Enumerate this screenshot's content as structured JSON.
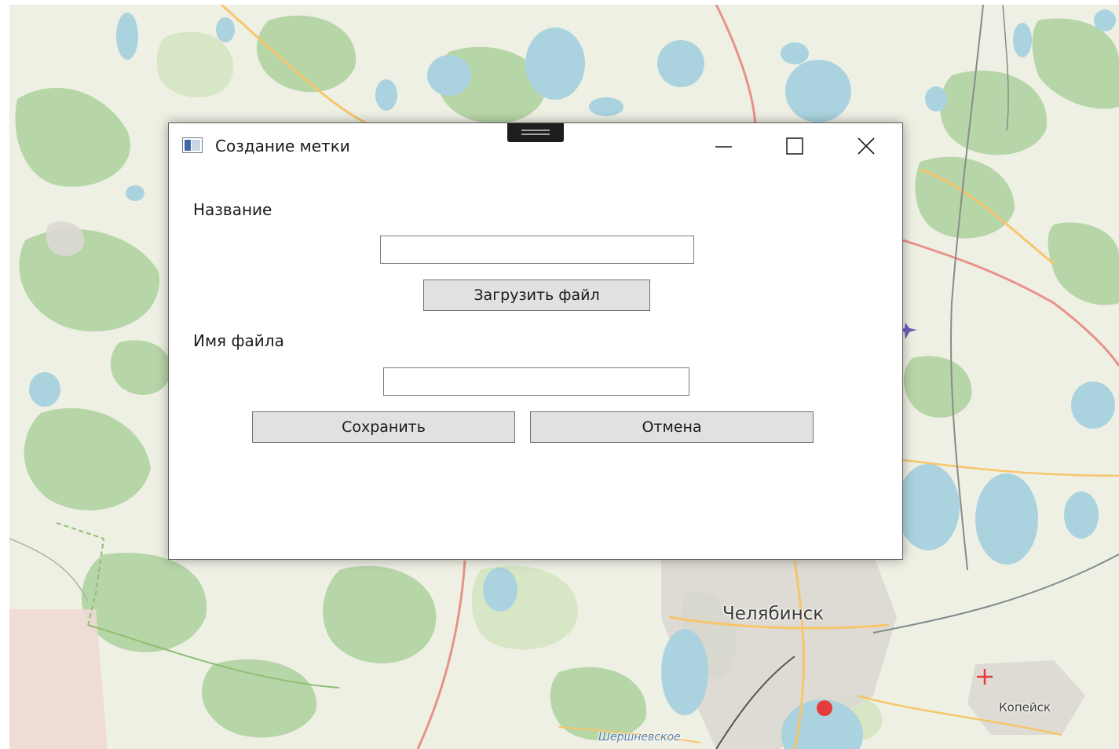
{
  "window": {
    "title": "Создание метки",
    "controls": {
      "minimize": "minimize-icon",
      "maximize": "maximize-icon",
      "close": "close-icon"
    }
  },
  "form": {
    "name_label": "Название",
    "name_value": "",
    "upload_button": "Загрузить файл",
    "filename_label": "Имя файла",
    "filename_value": "",
    "save_button": "Сохранить",
    "cancel_button": "Отмена"
  },
  "map": {
    "city_labels": [
      "Челябинск",
      "Копейск",
      "Шершневское"
    ],
    "markers": [
      "red-dot-marker",
      "hospital-cross-marker",
      "airport-marker"
    ]
  },
  "colors": {
    "map_background": "#eef0e4",
    "water": "#aad3df",
    "forest": "#add19e",
    "major_road": "#f7c56b",
    "primary_road": "#e8928a",
    "marker_red": "#e63b3b",
    "button_face": "#e1e1e1"
  }
}
